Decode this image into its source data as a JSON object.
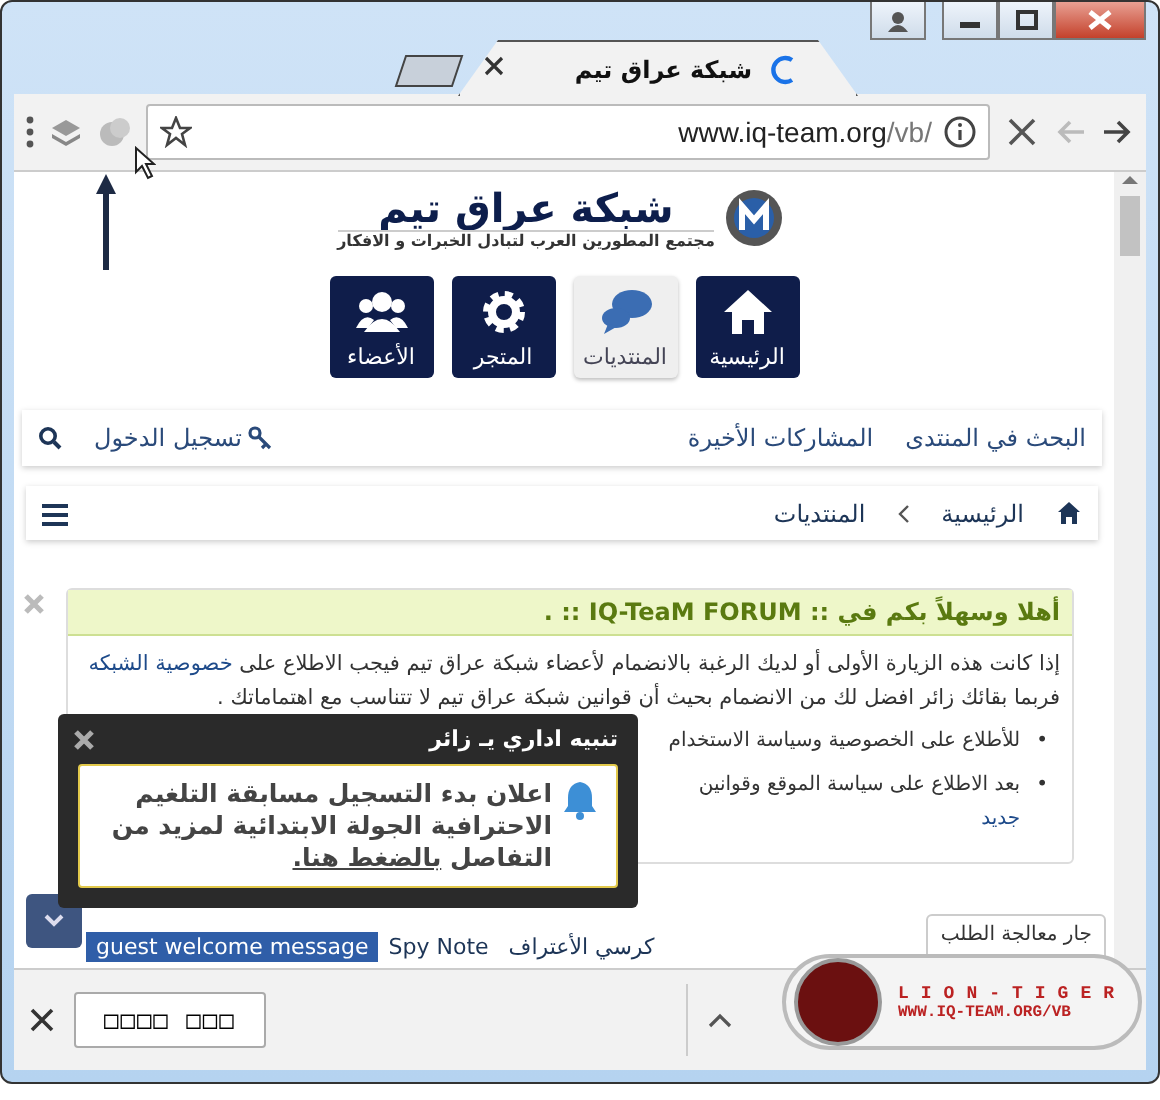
{
  "browser": {
    "tab_title": "شبكة عراق تيم",
    "url_host": "www.iq-team.org",
    "url_path": "/vb/"
  },
  "site": {
    "logo_title": "شبكة عراق تيم",
    "logo_tagline": "مجتمع المطورين العرب لتبادل الخبرات و الافكار"
  },
  "main_nav": [
    {
      "label": "الرئيسية",
      "selected": false
    },
    {
      "label": "المنتديات",
      "selected": true
    },
    {
      "label": "المتجر",
      "selected": false
    },
    {
      "label": "الأعضاء",
      "selected": false
    }
  ],
  "top_links": [
    "البحث في المنتدى",
    "المشاركات الأخيرة"
  ],
  "login": "تسجيل الدخول",
  "breadcrumb": [
    "الرئيسية",
    "المنتديات"
  ],
  "notice": {
    "title": "أهلا وسهلاً بكم في :: IQ-TeaM FORUM :: .",
    "text_before": "إذا كانت هذه الزيارة الأولى أو لديك الرغبة بالانضمام لأعضاء شبكة عراق تيم فيجب الاطلاع على",
    "link": "خصوصية الشبكه",
    "text_after": "فربما بقائك زائر افضل لك من الانضمام بحيث أن قوانين شبكة عراق تيم لا تتناسب مع اهتماماتك .",
    "bullets": [
      {
        "marker": "•",
        "text": "للأطلاع على الخصوصية وسياسة الاستخدام"
      },
      {
        "marker": "•",
        "text": "بعد الاطلاع على سياسة الموقع وقوانين",
        "link": "جديد"
      }
    ]
  },
  "popup": {
    "title": "تنبيه اداري يـ زائر",
    "message": "اعلان بدء التسجيل مسابقة التلغيم الاحترافية الجولة الابتدائية لمزيد من التفاصل",
    "link": "بالضغط هنا."
  },
  "bottom_tabs": [
    {
      "label": "كرسي الأعتراف",
      "selected": false
    },
    {
      "label": "Spy Note",
      "selected": false
    },
    {
      "label": "guest welcome message",
      "selected": true
    }
  ],
  "status": "جار معالجة الطلب",
  "download": {
    "button": "□□□□ □□□",
    "badge_title": "LION-TIGER",
    "badge_url": "WWW.IQ-TEAM.ORG/VB"
  }
}
